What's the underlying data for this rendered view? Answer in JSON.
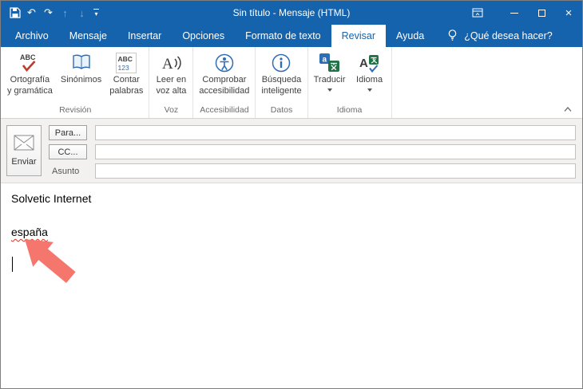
{
  "colors": {
    "titlebar_blue": "#1463ac",
    "arrow_salmon": "#f4766d",
    "squiggle_red": "#d93025"
  },
  "titlebar": {
    "title": "Sin título  -  Mensaje (HTML)",
    "qat": {
      "undo": "↶",
      "redo": "↷",
      "prev": "↑",
      "next": "↓",
      "customize": "▾"
    },
    "controls": {
      "close": "×"
    }
  },
  "tabs": {
    "archivo": "Archivo",
    "mensaje": "Mensaje",
    "insertar": "Insertar",
    "opciones": "Opciones",
    "formato": "Formato de texto",
    "revisar": "Revisar",
    "ayuda": "Ayuda",
    "tellme": "¿Qué desea hacer?"
  },
  "ribbon": {
    "spelling": {
      "l1": "Ortografía",
      "l2": "y gramática"
    },
    "thesaurus": {
      "l1": "Sinónimos",
      "l2": ""
    },
    "wordcount": {
      "l1": "Contar",
      "l2": "palabras"
    },
    "readaloud": {
      "l1": "Leer en",
      "l2": "voz alta"
    },
    "accessibility": {
      "l1": "Comprobar",
      "l2": "accesibilidad"
    },
    "smartlookup": {
      "l1": "Búsqueda",
      "l2": "inteligente"
    },
    "translate": {
      "l1": "Traducir",
      "l2": ""
    },
    "language": {
      "l1": "Idioma",
      "l2": ""
    },
    "groups": {
      "revision": "Revisión",
      "voz": "Voz",
      "accesibilidad": "Accesibilidad",
      "datos": "Datos",
      "idioma": "Idioma"
    }
  },
  "compose": {
    "send": "Enviar",
    "to_button": "Para...",
    "cc_button": "CC...",
    "subject_label": "Asunto",
    "to_value": "",
    "cc_value": "",
    "subject_value": ""
  },
  "body": {
    "line1": "Solvetic Internet",
    "misspelled": "españa"
  }
}
